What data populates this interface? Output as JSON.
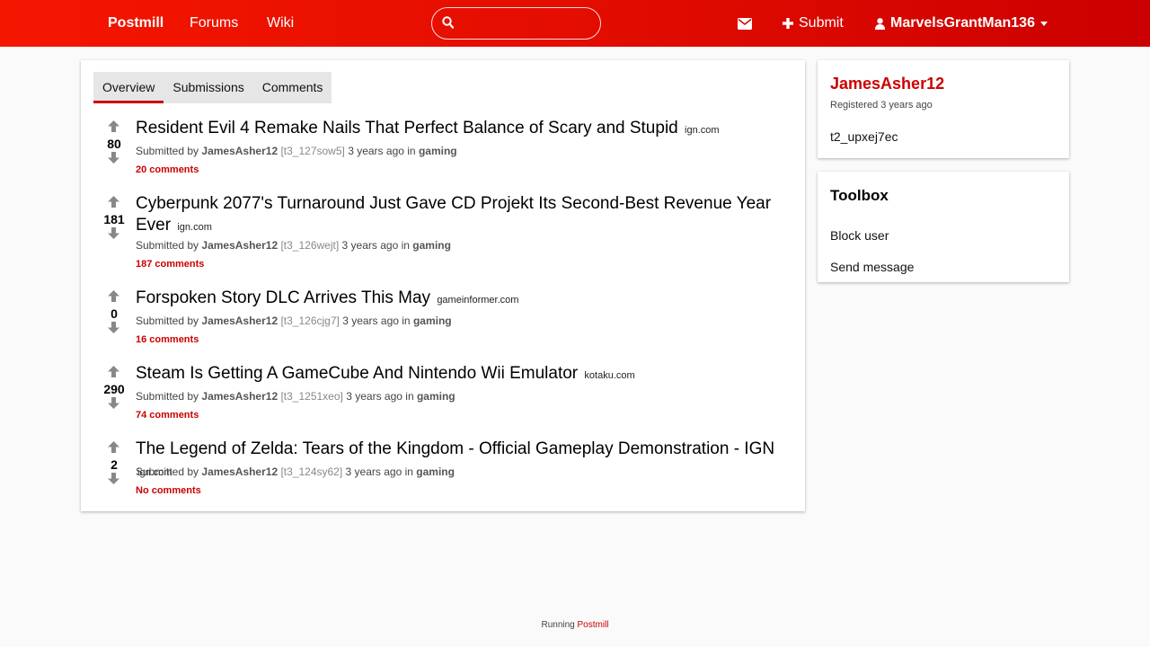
{
  "header": {
    "brand": "Postmill",
    "nav": [
      "Forums",
      "Wiki"
    ],
    "search_placeholder": "",
    "submit_label": "Submit",
    "username": "MarvelsGrantMan136",
    "icons": [
      "search-icon",
      "envelope-icon",
      "plus-icon",
      "user-icon",
      "caret-down-icon",
      "arrow-up-icon",
      "arrow-down-icon"
    ]
  },
  "tabs": [
    {
      "label": "Overview",
      "active": true
    },
    {
      "label": "Submissions",
      "active": false
    },
    {
      "label": "Comments",
      "active": false
    }
  ],
  "posts": [
    {
      "score": "80",
      "title": "Resident Evil 4 Remake Nails That Perfect Balance of Scary and Stupid",
      "domain": "ign.com",
      "submitted_by": "Submitted by",
      "author": "JamesAsher12",
      "id": "[t3_127sow5]",
      "time": "3 years ago",
      "in": "in",
      "forum": "gaming",
      "comments": "20 comments"
    },
    {
      "score": "181",
      "title": "Cyberpunk 2077's Turnaround Just Gave CD Projekt Its Second-Best Revenue Year Ever",
      "domain": "ign.com",
      "submitted_by": "Submitted by",
      "author": "JamesAsher12",
      "id": "[t3_126wejt]",
      "time": "3 years ago",
      "in": "in",
      "forum": "gaming",
      "comments": "187 comments"
    },
    {
      "score": "0",
      "title": "Forspoken Story DLC Arrives This May",
      "domain": "gameinformer.com",
      "submitted_by": "Submitted by",
      "author": "JamesAsher12",
      "id": "[t3_126cjg7]",
      "time": "3 years ago",
      "in": "in",
      "forum": "gaming",
      "comments": "16 comments"
    },
    {
      "score": "290",
      "title": "Steam Is Getting A GameCube And Nintendo Wii Emulator",
      "domain": "kotaku.com",
      "submitted_by": "Submitted by",
      "author": "JamesAsher12",
      "id": "[t3_1251xeo]",
      "time": "3 years ago",
      "in": "in",
      "forum": "gaming",
      "comments": "74 comments"
    },
    {
      "score": "2",
      "title": "The Legend of Zelda: Tears of the Kingdom - Official Gameplay Demonstration - IGN",
      "domain": "ign.com",
      "submitted_by": "Submitted by",
      "author": "JamesAsher12",
      "id": "[t3_124sy62]",
      "time": "3 years ago",
      "in": "in",
      "forum": "gaming",
      "comments": "No comments"
    }
  ],
  "sidebar": {
    "username": "JamesAsher12",
    "registered": "Registered 3 years ago",
    "user_id": "t2_upxej7ec",
    "toolbox_title": "Toolbox",
    "block_user": "Block user",
    "send_message": "Send message"
  },
  "footer": {
    "running": "Running",
    "link": "Postmill"
  },
  "colors": {
    "accent": "#cc0000",
    "header_start": "#f51600",
    "header_end": "#cc0000"
  }
}
